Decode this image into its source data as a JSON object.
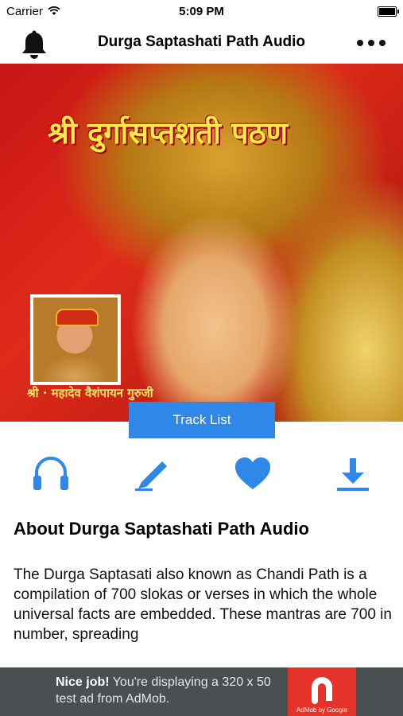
{
  "status": {
    "carrier": "Carrier",
    "time": "5:09 PM"
  },
  "nav": {
    "title": "Durga Saptashati Path Audio"
  },
  "hero": {
    "title": "श्री दुर्गासप्तशती पठण",
    "caption": "श्री · महादेव वैशंपायन गुरुजी"
  },
  "track_list_button": "Track List",
  "actions": [
    {
      "name": "listen",
      "icon": "headphones-icon"
    },
    {
      "name": "edit",
      "icon": "pen-icon"
    },
    {
      "name": "favorite",
      "icon": "heart-icon"
    },
    {
      "name": "download",
      "icon": "download-icon"
    }
  ],
  "about": {
    "title": "About Durga Saptashati Path Audio",
    "text": "The Durga Saptasati also known as Chandi Path is a compilation of 700 slokas or verses in which the whole universal facts are embedded. These mantras are 700 in number, spreading"
  },
  "ad": {
    "highlight": "Nice job!",
    "text": " You're displaying a 320 x 50 test ad from AdMob.",
    "logo_caption": "AdMob by Google"
  },
  "colors": {
    "accent": "#2f87e8",
    "ad_background": "#4a4f52",
    "admob_red": "#e5332a"
  }
}
